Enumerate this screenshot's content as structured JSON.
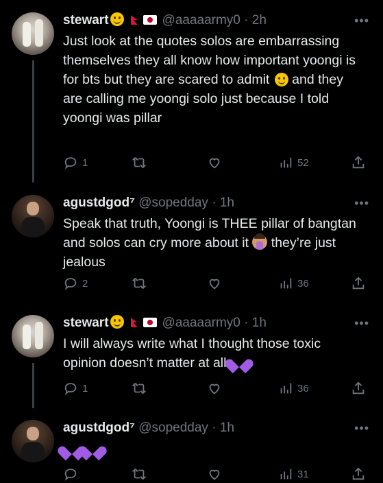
{
  "tweets": [
    {
      "name": "stewart",
      "handle": "@aaaaarmy0",
      "time": "2h",
      "text_parts": [
        "Just look at the quotes solos are embarrassing themselves they all know how important yoongi is for bts but they are scared to admit ",
        " and they are calling me yoongi solo just because I told yoongi was pillar"
      ],
      "replies": "1",
      "retweets": "",
      "likes": "",
      "views": "52"
    },
    {
      "name": "agustdgod⁷",
      "handle": "@sopedday",
      "time": "1h",
      "text_parts": [
        "Speak that truth, Yoongi is THEE pillar of bangtan and solos can cry more about it ",
        " they’re just jealous"
      ],
      "replies": "2",
      "retweets": "",
      "likes": "",
      "views": "36"
    },
    {
      "name": "stewart",
      "handle": "@aaaaarmy0",
      "time": "1h",
      "text_parts": [
        "I will always write what I thought those toxic opinion doesn’t matter at all ",
        ""
      ],
      "replies": "1",
      "retweets": "",
      "likes": "",
      "views": "36"
    },
    {
      "name": "agustdgod⁷",
      "handle": "@sopedday",
      "time": "1h",
      "text_parts": [
        "",
        ""
      ],
      "replies": "",
      "retweets": "",
      "likes": "",
      "views": "31"
    }
  ],
  "ui": {
    "dot": "·",
    "more": "•••"
  },
  "icons": [
    "reply-icon",
    "retweet-icon",
    "like-icon",
    "views-icon",
    "share-icon",
    "more-icon",
    "smile-emoji",
    "woman-shrugging-emoji",
    "purple-heart-emoji",
    "nepal-flag",
    "japan-flag"
  ],
  "colors": {
    "background": "#000000",
    "text": "#e7e9ea",
    "muted": "#71767b",
    "heart": "#a15ce6"
  }
}
